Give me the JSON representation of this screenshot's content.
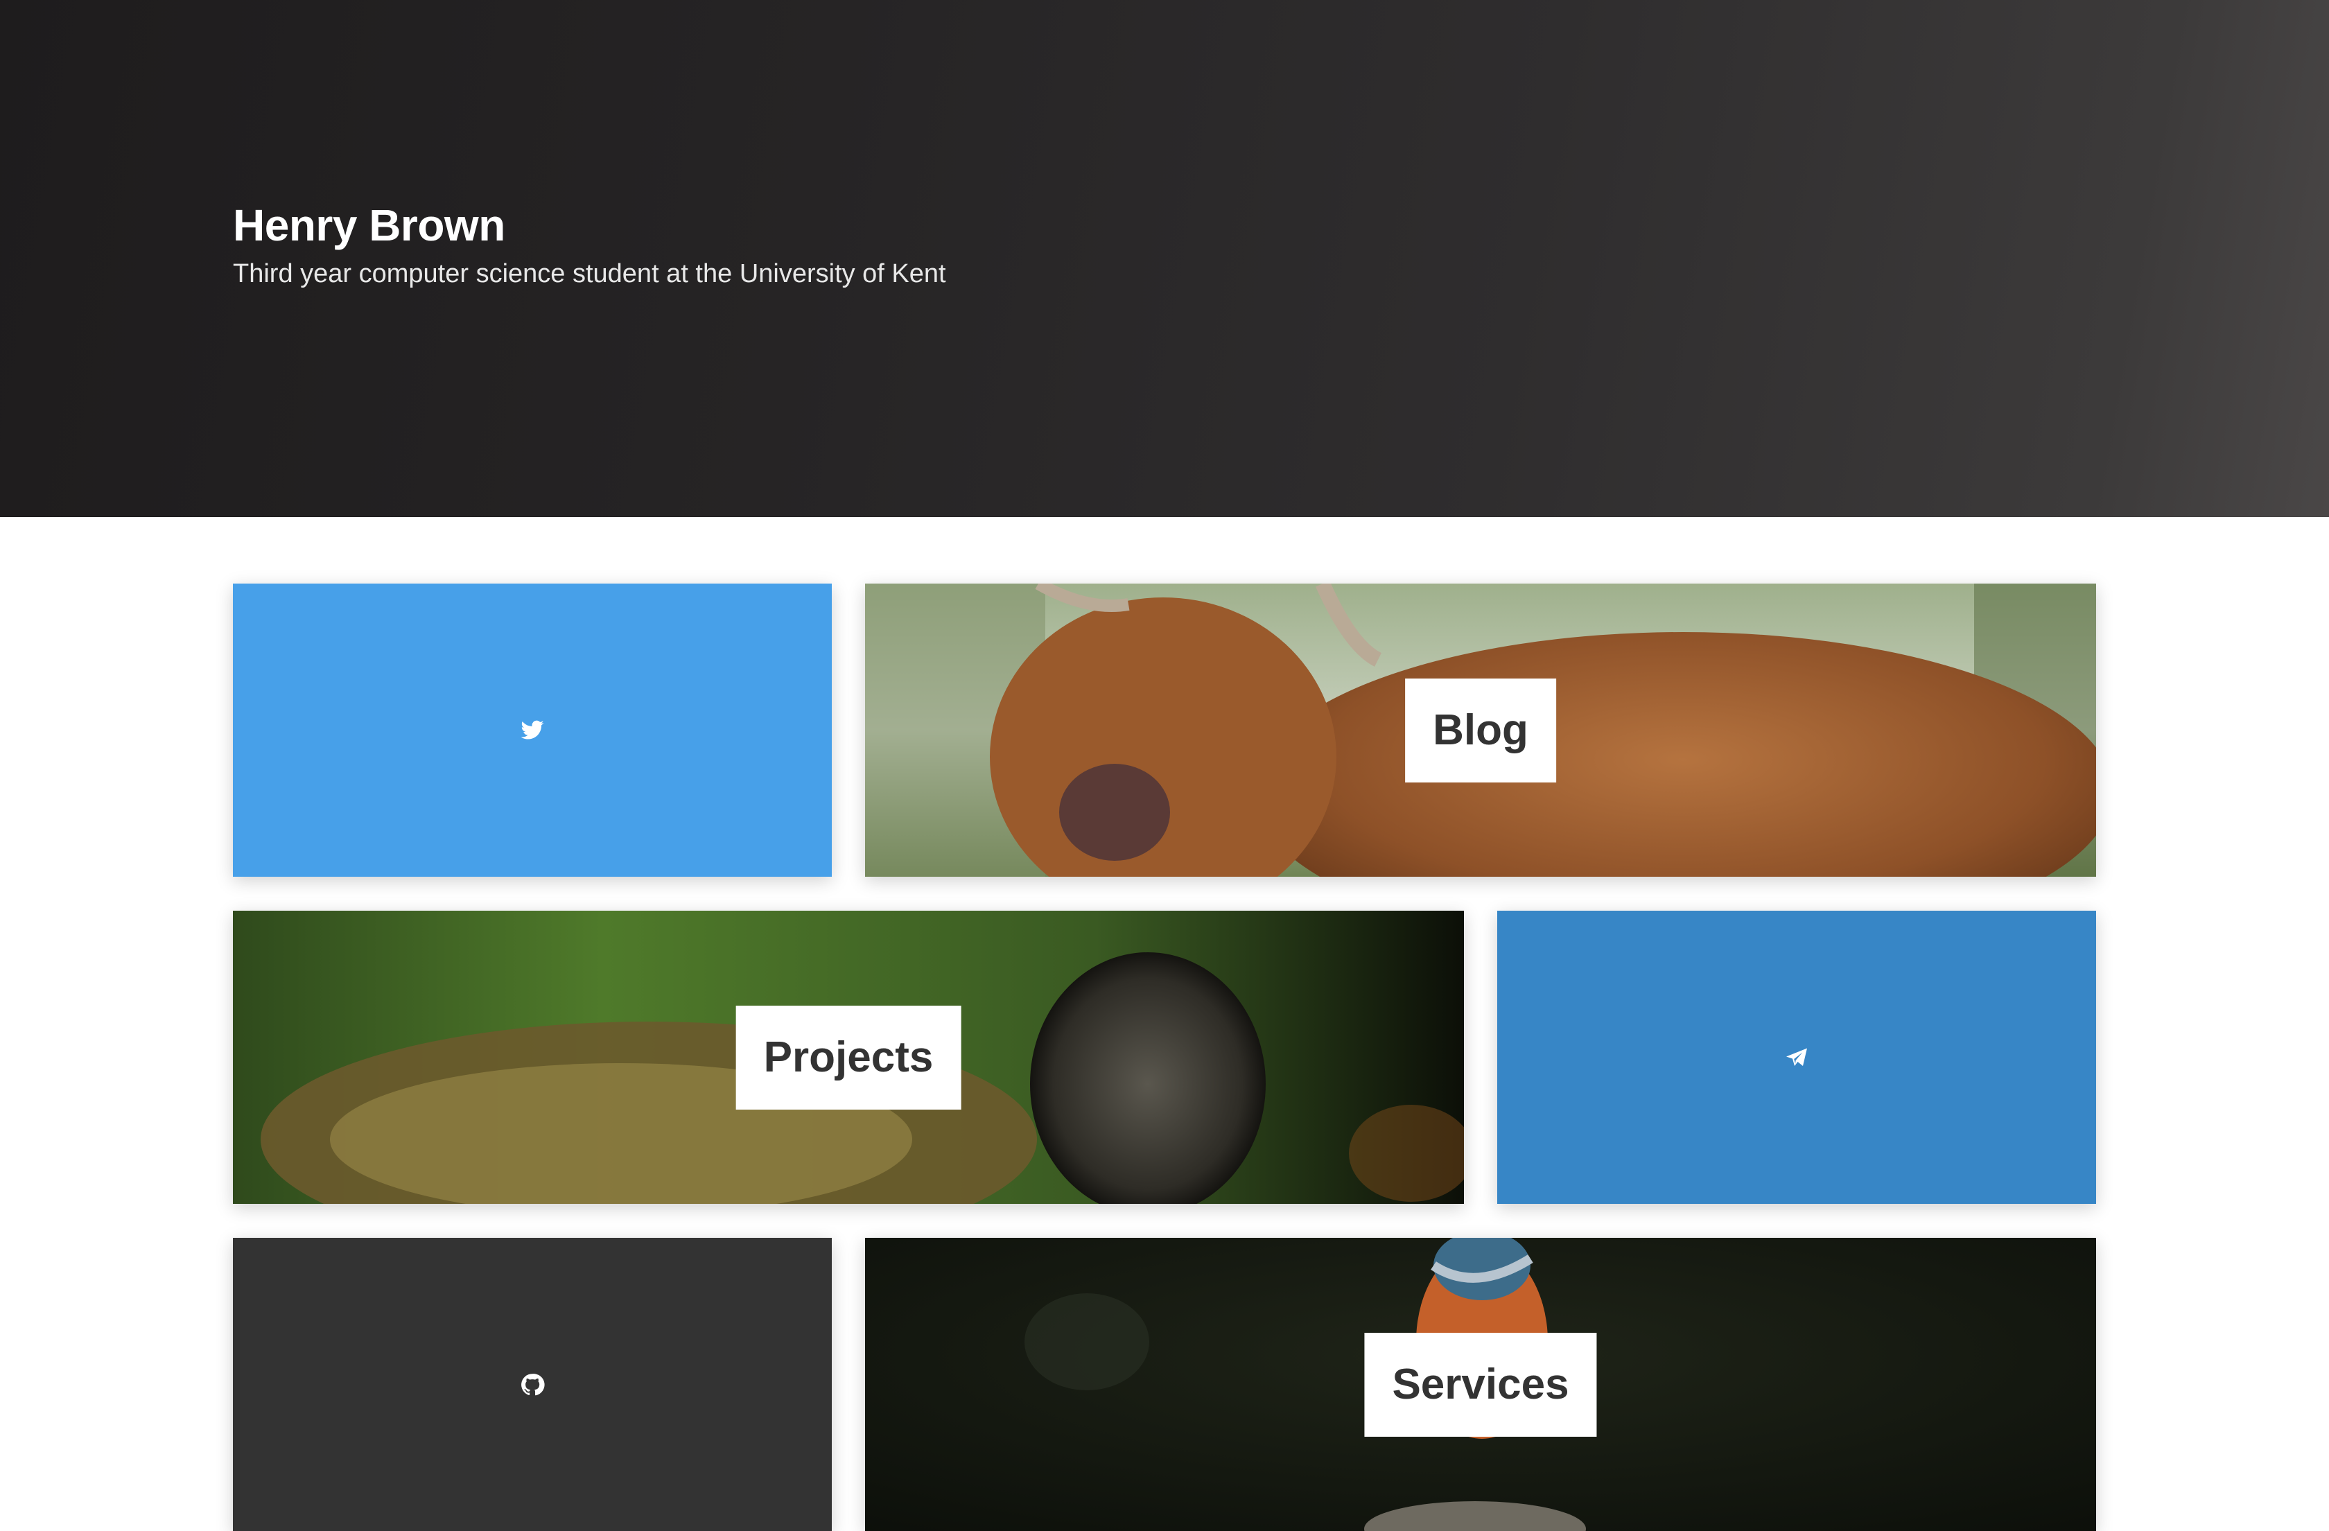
{
  "hero": {
    "title": "Henry Brown",
    "subtitle": "Third year computer science student at the University of Kent"
  },
  "tiles": {
    "twitter": {
      "icon": "twitter-icon",
      "color": "#47a0e9"
    },
    "blog": {
      "label": "Blog",
      "image": "highland-cow-photo"
    },
    "projects": {
      "label": "Projects",
      "image": "fly-macro-photo"
    },
    "telegram": {
      "icon": "telegram-icon",
      "color": "#3786c6"
    },
    "github": {
      "icon": "github-icon",
      "color": "#333333"
    },
    "services": {
      "label": "Services",
      "image": "kingfisher-photo"
    }
  }
}
